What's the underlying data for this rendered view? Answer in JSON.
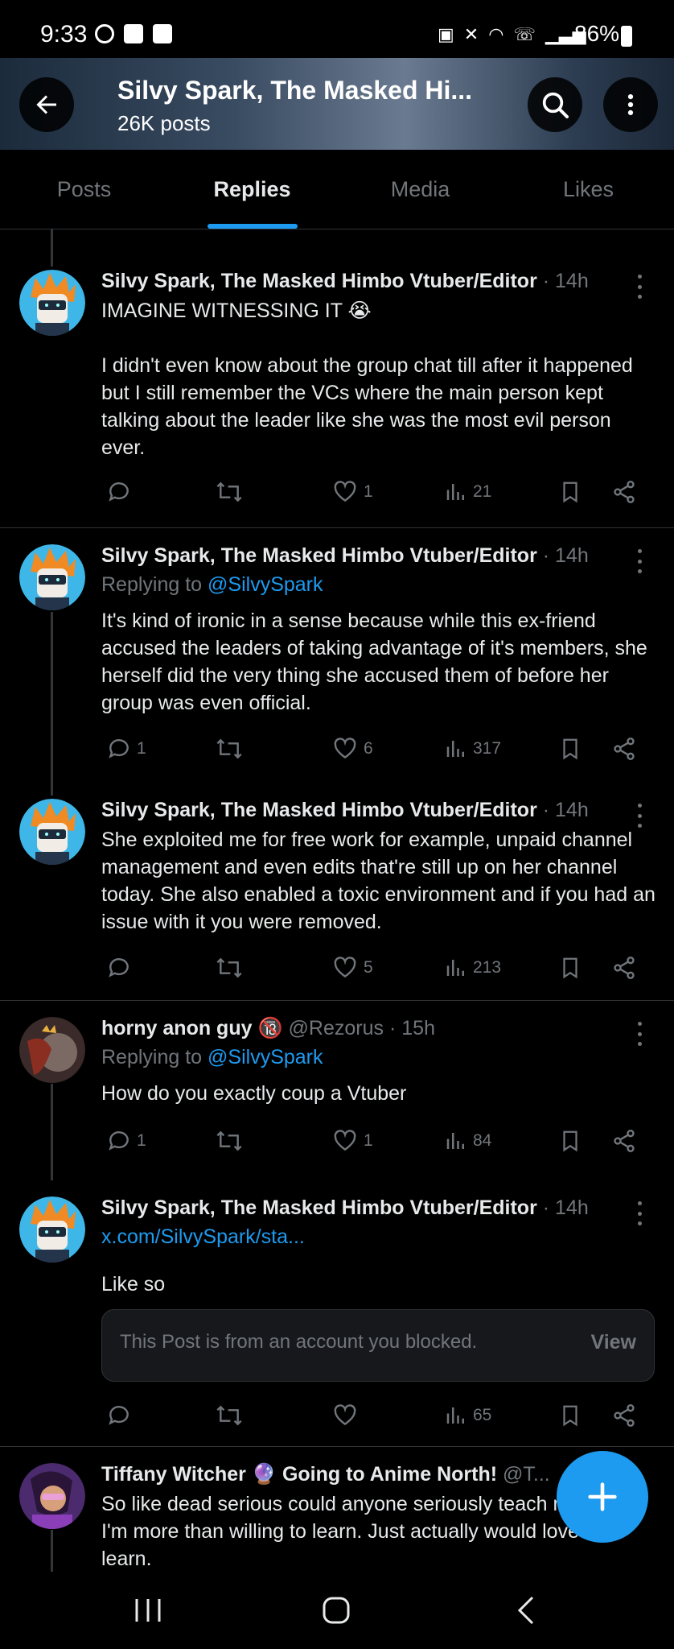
{
  "status_bar": {
    "time": "9:33",
    "battery": "86%"
  },
  "header": {
    "title": "Silvy Spark, The Masked Hi...",
    "post_count": "26K posts"
  },
  "tabs": [
    {
      "label": "Posts",
      "active": false
    },
    {
      "label": "Replies",
      "active": true
    },
    {
      "label": "Media",
      "active": false
    },
    {
      "label": "Likes",
      "active": false
    }
  ],
  "posts": [
    {
      "author": "Silvy Spark, The Masked Himbo Vtuber/Editor",
      "time": "· 14h",
      "text": "IMAGINE WITNESSING IT 😭",
      "text2": "I didn't even know about the group chat till after it happened but I still remember the VCs where the main person kept talking about the leader like she was the most evil person ever.",
      "replies": "",
      "likes": "1",
      "views": "21"
    },
    {
      "author": "Silvy Spark, The Masked Himbo Vtuber/Editor",
      "time": "· 14h",
      "replying_prefix": "Replying to",
      "replying_handle": "@SilvySpark",
      "text": "It's kind of ironic in a sense because while this ex-friend accused the leaders of taking advantage of it's members, she herself did the very thing she accused them of before her group was even official.",
      "replies": "1",
      "likes": "6",
      "views": "317"
    },
    {
      "author": "Silvy Spark, The Masked Himbo Vtuber/Editor",
      "time": "· 14h",
      "text": "She exploited me for free work for example, unpaid channel management and even edits that're still up on her channel today. She also enabled a toxic environment and if you had an issue with it you were removed.",
      "replies": "",
      "likes": "5",
      "views": "213"
    },
    {
      "author": "horny anon guy",
      "badge": "🔞",
      "handle": "@Rezorus",
      "time": "· 15h",
      "replying_prefix": "Replying to",
      "replying_handle": "@SilvySpark",
      "text": "How do you exactly coup a Vtuber",
      "replies": "1",
      "likes": "1",
      "views": "84"
    },
    {
      "author": "Silvy Spark, The Masked Himbo Vtuber/Editor",
      "time": "· 14h",
      "link": "x.com/SilvySpark/sta...",
      "text": "Like so",
      "blocked_message": "This Post is from an account you blocked.",
      "blocked_action": "View",
      "replies": "",
      "likes": "",
      "views": "65"
    },
    {
      "author": "Tiffany Witcher",
      "badge": "🔮",
      "author_suffix": "Going to Anime North!",
      "handle": "@T...",
      "text": "So like dead serious could anyone seriously teach me Apex. I'm more than willing to learn. Just actually would love to learn."
    }
  ],
  "colors": {
    "accent": "#1d9bf0",
    "muted": "#71767b",
    "text": "#e7e9ea",
    "background": "#000000",
    "divider": "#2f3336"
  },
  "icons": [
    "back-arrow-icon",
    "search-icon",
    "more-vertical-icon",
    "reply-icon",
    "repost-icon",
    "like-icon",
    "views-icon",
    "bookmark-icon",
    "share-icon",
    "compose-plus-icon"
  ]
}
